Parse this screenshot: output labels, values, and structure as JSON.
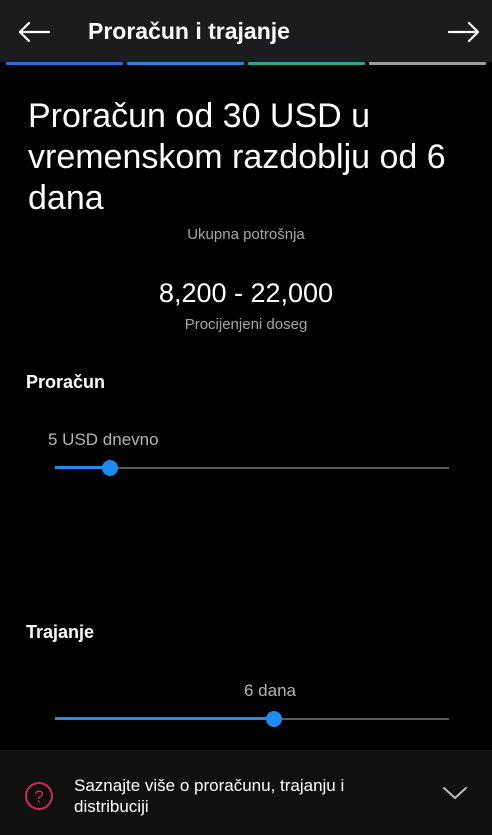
{
  "header": {
    "title": "Proračun i trajanje",
    "back_icon": "arrow-left-icon",
    "next_icon": "arrow-right-icon",
    "progress_colors": [
      "#2b6fd8",
      "#2f86e0",
      "#27a794",
      "#9e9e9e"
    ]
  },
  "summary": {
    "title": "Proračun od 30 USD u vremenskom razdoblju od 6 dana",
    "spend_label": "Ukupna potrošnja",
    "reach_value": "8,200 - 22,000",
    "reach_label": "Procijenjeni doseg"
  },
  "budget": {
    "label": "Proračun",
    "value_text": "5 USD dnevno",
    "slider_fraction": 0.14
  },
  "duration": {
    "label": "Trajanje",
    "value_text": "6 dana",
    "slider_fraction": 0.556
  },
  "footer": {
    "text": "Saznajte više o proračunu, trajanju i distribuciji",
    "help_icon": "question-circle-icon",
    "expand_icon": "chevron-down-icon"
  },
  "colors": {
    "accent": "#1d8cf0",
    "help_icon": "#d0285a"
  }
}
